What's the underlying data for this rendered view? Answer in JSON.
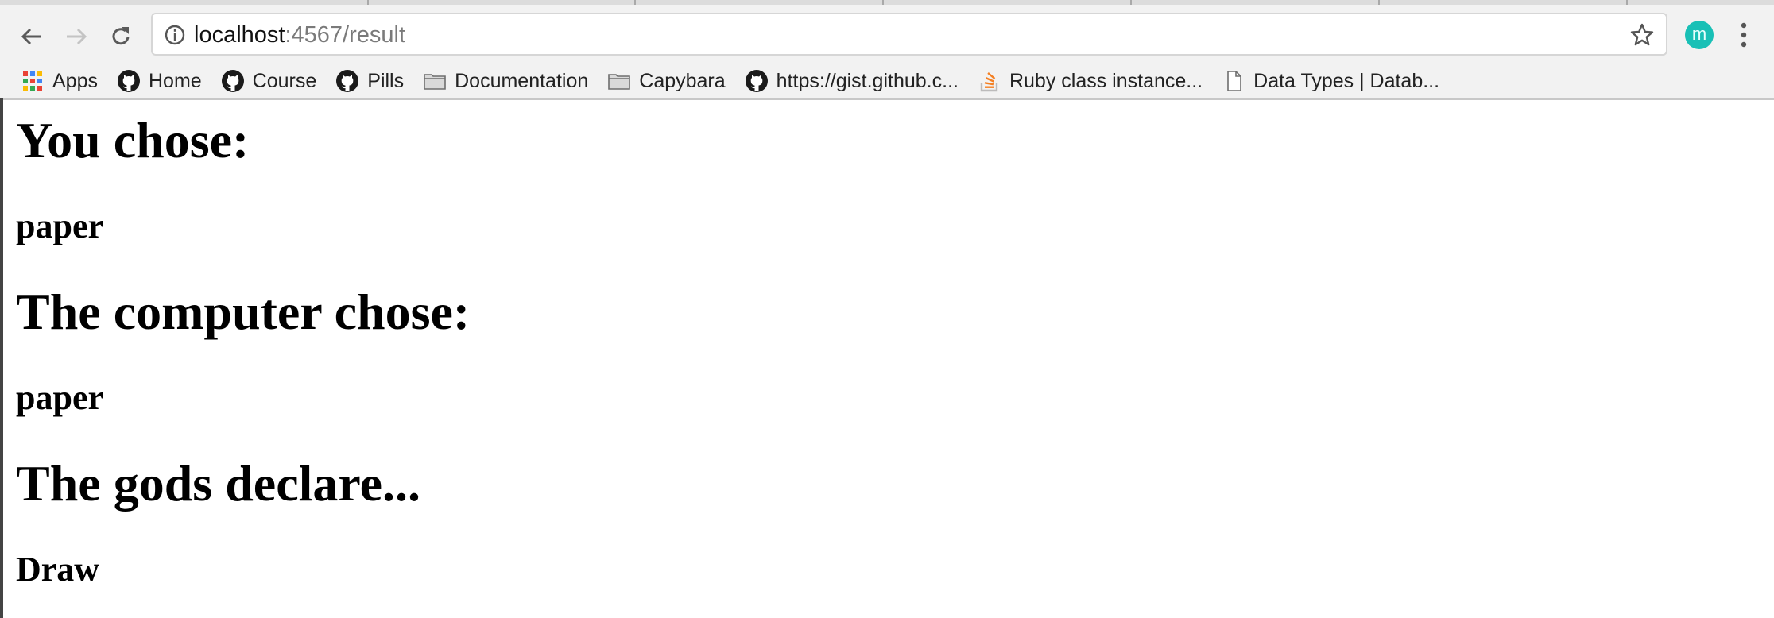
{
  "browser": {
    "url_host": "localhost",
    "url_port_path": ":4567/result",
    "avatar_letter": "m",
    "accent_color": "#19c0b6"
  },
  "bookmarks": [
    {
      "label": "Apps",
      "icon": "apps-grid-icon"
    },
    {
      "label": "Home",
      "icon": "github-icon"
    },
    {
      "label": "Course",
      "icon": "github-icon"
    },
    {
      "label": "Pills",
      "icon": "github-icon"
    },
    {
      "label": "Documentation",
      "icon": "folder-icon"
    },
    {
      "label": "Capybara",
      "icon": "folder-icon"
    },
    {
      "label": "https://gist.github.c...",
      "icon": "github-icon"
    },
    {
      "label": "Ruby class instance...",
      "icon": "stackoverflow-icon"
    },
    {
      "label": "Data Types | Datab...",
      "icon": "page-icon"
    }
  ],
  "result": {
    "you_chose_heading": "You chose:",
    "you_chose_value": "paper",
    "computer_chose_heading": "The computer chose:",
    "computer_chose_value": "paper",
    "verdict_heading": "The gods declare...",
    "verdict_value": "Draw"
  }
}
